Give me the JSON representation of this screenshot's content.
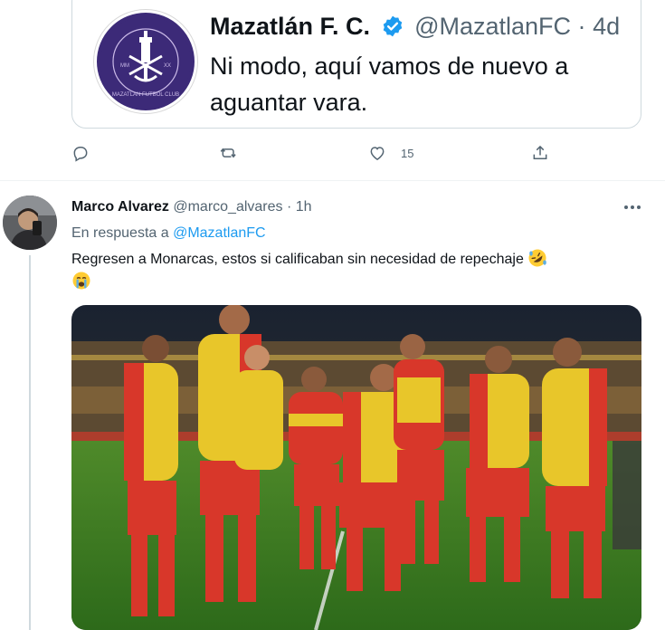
{
  "quoted_tweet": {
    "name": "Mazatlán F. C.",
    "handle": "@MazatlanFC",
    "dot": "·",
    "time": "4d",
    "text": "Ni modo, aquí vamos de nuevo a aguantar vara.",
    "logo_text_top": "MMXX",
    "logo_text_ring": "MAZATLAN FUTBOL CLUB"
  },
  "actions": {
    "reply_count": "",
    "retweet_count": "",
    "like_count": "15",
    "share_count": ""
  },
  "reply_tweet": {
    "name": "Marco Alvarez",
    "handle": "@marco_alvares",
    "dot": "·",
    "time": "1h",
    "replying_prefix": "En respuesta a",
    "replying_handle": "@MazatlanFC",
    "text": "Regresen a Monarcas, estos si calificaban sin necesidad de repechaje",
    "emojis": [
      "rolling-on-floor-laughing",
      "loudly-crying-face"
    ]
  },
  "colors": {
    "accent": "#1d9bf0",
    "secondary_text": "#536471",
    "border": "#cfd9de",
    "club_purple": "#3c2a78"
  }
}
